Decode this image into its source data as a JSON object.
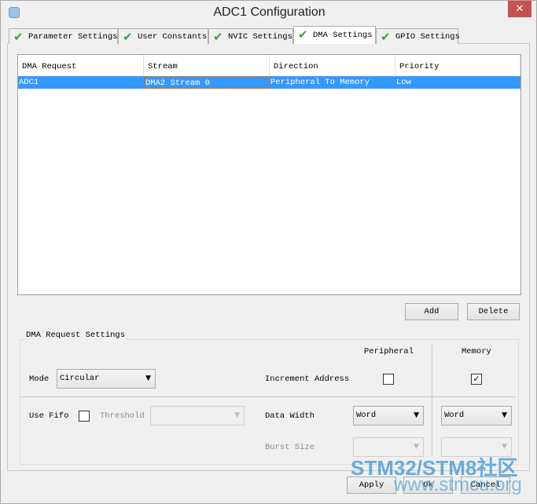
{
  "window": {
    "title": "ADC1 Configuration",
    "close_icon": "close-icon",
    "app_icon": "stm32cube-icon"
  },
  "tabs": [
    {
      "label": "Parameter Settings",
      "status_icon": "check-icon"
    },
    {
      "label": "User Constants",
      "status_icon": "check-icon"
    },
    {
      "label": "NVIC Settings",
      "status_icon": "check-icon"
    },
    {
      "label": "DMA Settings",
      "status_icon": "check-icon",
      "selected": true
    },
    {
      "label": "GPIO Settings",
      "status_icon": "check-icon"
    }
  ],
  "table": {
    "columns": [
      "DMA Request",
      "Stream",
      "Direction",
      "Priority"
    ],
    "rows": [
      [
        "ADC1",
        "DMA2 Stream 0",
        "Peripheral To Memory",
        "Low"
      ]
    ],
    "selection_color": "#3399ff"
  },
  "buttons": {
    "add": "Add",
    "delete": "Delete",
    "apply": "Apply",
    "ok": "Ok",
    "cancel": "Cancel"
  },
  "settings": {
    "title": "DMA Request Settings",
    "peripheral_header": "Peripheral",
    "memory_header": "Memory",
    "mode_label": "Mode",
    "mode_value": "Circular",
    "increment_label": "Increment Address",
    "increment_peripheral": false,
    "increment_memory": true,
    "fifo_label": "Use Fifo",
    "use_fifo": false,
    "threshold_label": "Threshold",
    "threshold_value": "",
    "data_width_label": "Data Width",
    "data_width_peripheral": "Word",
    "data_width_memory": "Word",
    "burst_label": "Burst Size",
    "burst_peripheral": "",
    "burst_memory": ""
  },
  "watermark": {
    "line1": "STM32/STM8社区",
    "line2": "www.stmcu.org"
  }
}
